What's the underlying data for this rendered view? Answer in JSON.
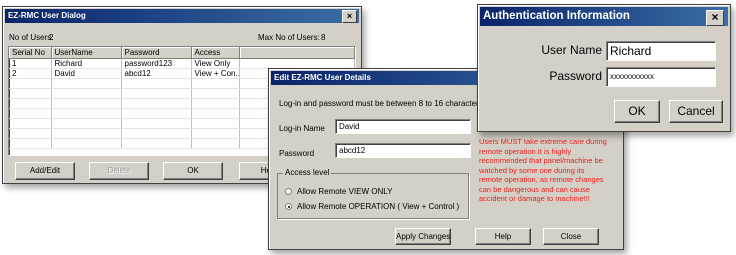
{
  "user_dialog": {
    "title": "EZ-RMC User Dialog",
    "close": "×",
    "num_users_label": "No of Users:",
    "num_users_value": "2",
    "max_users_label": "Max No of Users:",
    "max_users_value": "8",
    "columns": [
      "Serial No",
      "UserName",
      "Password",
      "Access"
    ],
    "rows": [
      [
        "1",
        "Richard",
        "password123",
        "View Only"
      ],
      [
        "2",
        "David",
        "abcd12",
        "View + Con..."
      ]
    ],
    "buttons": {
      "add_edit": "Add/Edit",
      "delete": "Delete",
      "ok": "OK",
      "help": "Help"
    }
  },
  "edit_dialog": {
    "title": "Edit EZ-RMC User Details",
    "note": "Log-in and password must be between 8 to 16 characters",
    "login_label": "Log-in Name",
    "login_value": "David",
    "password_label": "Password",
    "password_value": "abcd12",
    "access_group_label": "Access level",
    "radio_view": "Allow Remote VIEW ONLY",
    "radio_operation": "Allow Remote OPERATION ( View + Control )",
    "warning": "Users MUST take extreme care during remote operation.It is highly recommended that panel/machine be watched by some one during its remote operation, as remote changes can be dangerous and can cause accident or damage to machine!!!",
    "warning_color": "#e8201a",
    "buttons": {
      "apply": "Apply Changes",
      "help": "Help",
      "close": "Close"
    }
  },
  "auth_dialog": {
    "title": "Authentication Information",
    "close": "×",
    "username_label": "User Name",
    "username_value": "Richard",
    "password_label": "Password",
    "password_value": "xxxxxxxxxxx",
    "ok": "OK",
    "cancel": "Cancel"
  }
}
